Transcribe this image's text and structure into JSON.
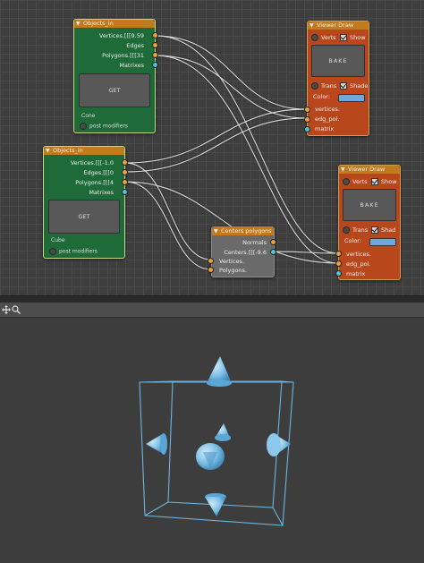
{
  "nodes": {
    "objects_in_cone": {
      "title": "Objects_in",
      "outputs": [
        "Vertices.[[[9.59",
        "Edges",
        "Polygons.[[[31",
        "Matrixes"
      ],
      "get_label": "GET",
      "object_name": "Cone",
      "post_modifiers": "post modifiers"
    },
    "objects_in_cube": {
      "title": "Objects_in",
      "outputs": [
        "Vertices.[[[-1.0",
        "Edges.[[[0",
        "Polygons.[[[4",
        "Matrixes"
      ],
      "get_label": "GET",
      "object_name": "Cube",
      "post_modifiers": "post modifiers"
    },
    "viewer_draw_top": {
      "title": "Viewer Draw",
      "verts_label": "Verts",
      "show_label": "Show",
      "bake_label": "BAKE",
      "trans_label": "Trans",
      "shade_label": "Shade",
      "color_label": "Color:",
      "inputs": [
        "vertices.",
        "edg_pol.",
        "matrix"
      ]
    },
    "viewer_draw_bottom": {
      "title": "Viewer Draw",
      "verts_label": "Verts",
      "show_label": "Show",
      "bake_label": "BAKE",
      "trans_label": "Trans",
      "shade_label": "Shad",
      "color_label": "Color:",
      "inputs": [
        "vertices.",
        "edg_pol.",
        "matrix"
      ]
    },
    "centers_polygons": {
      "title": "Centers polygons",
      "outputs": [
        "Normals",
        "Centers.[[[-9.6"
      ],
      "inputs": [
        "Vertices.",
        "Polygons."
      ]
    }
  },
  "colors": {
    "node_green": "#1e6a38",
    "node_orange": "#b9471c",
    "node_header": "#c17a1c",
    "socket_orange": "#e8a23c",
    "socket_cyan": "#4fc3d8",
    "viewer_color": "#6fa8dc",
    "wire_color": "#d8d8d8",
    "mesh_color": "#6cb4e0"
  },
  "viewport": {
    "header_icons": [
      "move-view-icon",
      "zoom-view-icon"
    ]
  }
}
